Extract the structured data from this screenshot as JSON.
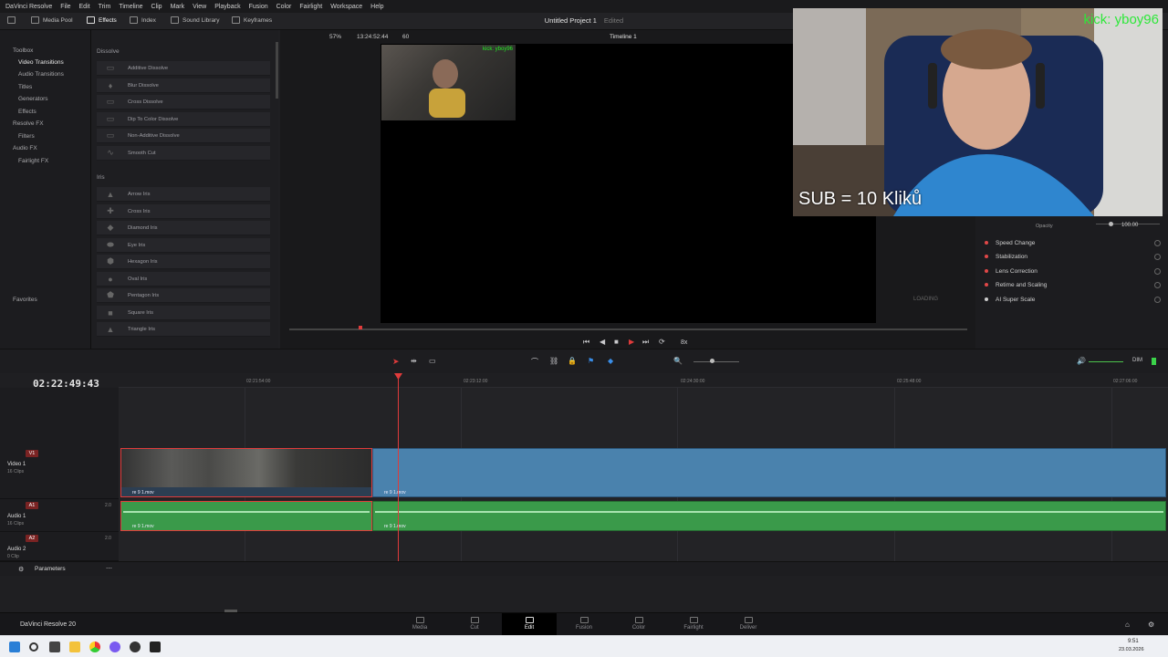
{
  "menubar": {
    "items": [
      "DaVinci Resolve",
      "File",
      "Edit",
      "Trim",
      "Timeline",
      "Clip",
      "Mark",
      "View",
      "Playback",
      "Fusion",
      "Color",
      "Fairlight",
      "Workspace",
      "Help"
    ]
  },
  "toolbar": {
    "media_pool": "Media Pool",
    "effects": "Effects",
    "index": "Index",
    "sound_library": "Sound Library",
    "keyframes": "Keyframes",
    "project_title": "Untitled Project 1",
    "project_status": "Edited"
  },
  "left_panel": {
    "items": [
      {
        "label": "Toolbox",
        "indent": 0
      },
      {
        "label": "Video Transitions",
        "indent": 1,
        "selected": true
      },
      {
        "label": "Audio Transitions",
        "indent": 1
      },
      {
        "label": "Titles",
        "indent": 1
      },
      {
        "label": "Generators",
        "indent": 1
      },
      {
        "label": "Effects",
        "indent": 1
      },
      {
        "label": "Resolve FX",
        "indent": 0
      },
      {
        "label": "Filters",
        "indent": 1
      },
      {
        "label": "Audio FX",
        "indent": 0
      },
      {
        "label": "Fairlight FX",
        "indent": 1
      }
    ],
    "favorites": "Favorites"
  },
  "effects_panel": {
    "dissolve_title": "Dissolve",
    "dissolve_items": [
      "Additive Dissolve",
      "Blur Dissolve",
      "Cross Dissolve",
      "Dip To Color Dissolve",
      "Non-Additive Dissolve",
      "Smooth Cut"
    ],
    "iris_title": "Iris",
    "iris_items": [
      "Arrow Iris",
      "Cross Iris",
      "Diamond Iris",
      "Eye Iris",
      "Hexagon Iris",
      "Oval Iris",
      "Pentagon Iris",
      "Square Iris",
      "Triangle Iris"
    ]
  },
  "viewer": {
    "zoom": "57%",
    "timecode": "13:24:52:44",
    "frame": "60",
    "timeline_name": "Timeline 1",
    "loading": "LOADING",
    "speed": "8x",
    "pip_overlay_text": "kick: yboy96"
  },
  "inspector": {
    "opacity_label": "Opacity",
    "opacity_value": "100.00",
    "rows": [
      {
        "label": "Speed Change",
        "dot": "red"
      },
      {
        "label": "Stabilization",
        "dot": "red"
      },
      {
        "label": "Lens Correction",
        "dot": "red"
      },
      {
        "label": "Retime and Scaling",
        "dot": "red"
      },
      {
        "label": "AI Super Scale",
        "dot": "white"
      }
    ]
  },
  "webcam": {
    "top_text": "kick: yboy96",
    "sub_text": "SUB = 10 Kliků"
  },
  "timeline": {
    "timecode": "02:22:49:43",
    "ruler_ticks": [
      "02:21:54:00",
      "02:23:12:00",
      "02:24:30:00",
      "02:25:48:00",
      "02:27:06:00"
    ],
    "tracks": [
      {
        "badge": "V1",
        "name": "Video 1",
        "sub": "16 Clips"
      },
      {
        "badge": "A1",
        "name": "Audio 1",
        "sub": "16 Clips",
        "level": "2.0"
      },
      {
        "badge": "A2",
        "name": "Audio 2",
        "sub": "0 Clip",
        "level": "2.0"
      }
    ],
    "clip_name": "re 9 1.mov",
    "parameters": "Parameters",
    "dim": "DIM"
  },
  "pages": {
    "items": [
      "Media",
      "Cut",
      "Edit",
      "Fusion",
      "Color",
      "Fairlight",
      "Deliver"
    ],
    "active": "Edit",
    "app_label": "DaVinci Resolve 20"
  },
  "taskbar": {
    "time": "9:51",
    "date": "23.03.2026"
  },
  "colors": {
    "accent_red": "#e03b3b",
    "video_clip": "#4a82ad",
    "audio_clip": "#3a9a4a"
  }
}
